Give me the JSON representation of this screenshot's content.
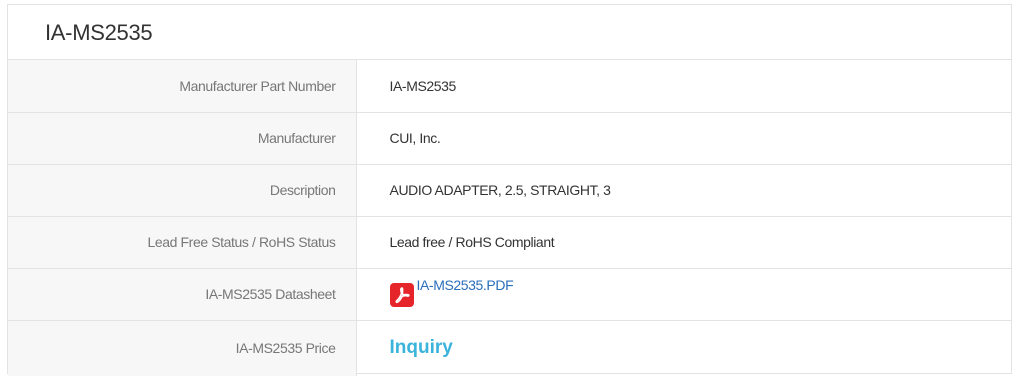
{
  "title": "IA-MS2535",
  "rows": [
    {
      "label": "Manufacturer Part Number",
      "value": "IA-MS2535"
    },
    {
      "label": "Manufacturer",
      "value": "CUI, Inc."
    },
    {
      "label": "Description",
      "value": "AUDIO ADAPTER, 2.5, STRAIGHT, 3"
    },
    {
      "label": "Lead Free Status / RoHS Status",
      "value": "Lead free / RoHS Compliant"
    },
    {
      "label": "IA-MS2535 Datasheet",
      "value": "IA-MS2535.PDF",
      "icon": "pdf-icon"
    },
    {
      "label": "IA-MS2535 Price",
      "value": "Inquiry"
    }
  ],
  "colors": {
    "link": "#2a6ebb",
    "inquiry": "#3bb4dc",
    "pdf_icon": "#e5252a",
    "border": "#e3e3e3",
    "label_bg": "#f7f7f7"
  }
}
